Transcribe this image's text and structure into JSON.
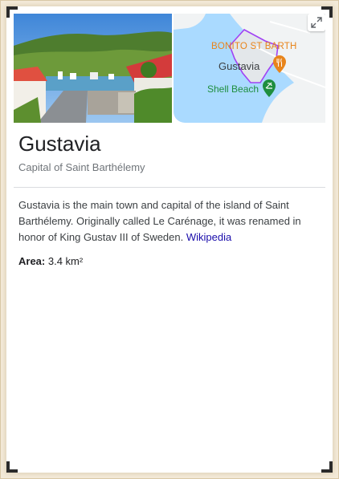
{
  "place": {
    "title": "Gustavia",
    "subtitle": "Capital of Saint Barthélemy"
  },
  "map": {
    "label_restaurant": "BONITO ST BARTH",
    "label_town": "Gustavia",
    "label_beach": "Shell Beach",
    "expand_icon": "expand-icon",
    "colors": {
      "water": "#aadaff",
      "land": "#f1f3f4",
      "boundary": "#a142f4",
      "restaurant": "#e8841b",
      "beach": "#1e8e3e"
    }
  },
  "description": {
    "text": "Gustavia is the main town and capital of the island of Saint Barthélemy. Originally called Le Carénage, it was renamed in honor of King Gustav III of Sweden.",
    "source_link": "Wikipedia"
  },
  "facts": {
    "area_label": "Area:",
    "area_value": "3.4 km²"
  }
}
